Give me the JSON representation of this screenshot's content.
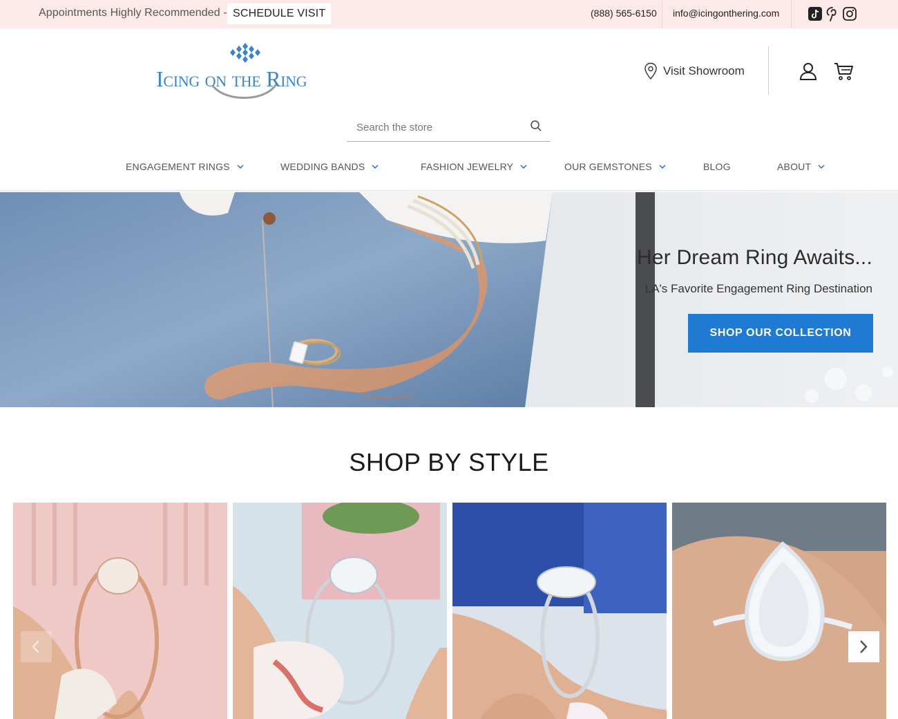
{
  "topbar": {
    "appointment_text": "Appointments Highly Recommended -",
    "schedule_label": "SCHEDULE VISIT",
    "phone": "(888) 565-6150",
    "email": "info@icingonthering.com",
    "social_icons": [
      "tiktok-icon",
      "pinterest-icon",
      "instagram-icon"
    ]
  },
  "header": {
    "logo_text": "Icing on the Ring",
    "visit_label": "Visit Showroom"
  },
  "search": {
    "placeholder": "Search the store"
  },
  "nav": {
    "items": [
      {
        "label": "ENGAGEMENT RINGS",
        "has_dropdown": true
      },
      {
        "label": "WEDDING BANDS",
        "has_dropdown": true
      },
      {
        "label": "FASHION JEWELRY",
        "has_dropdown": true
      },
      {
        "label": "OUR GEMSTONES",
        "has_dropdown": true
      },
      {
        "label": "BLOG",
        "has_dropdown": false
      },
      {
        "label": "ABOUT",
        "has_dropdown": true
      }
    ]
  },
  "hero": {
    "title": "Her Dream Ring Awaits...",
    "subtitle": "LA's Favorite Engagement Ring Destination",
    "button_label": "SHOP OUR COLLECTION"
  },
  "section": {
    "title": "SHOP BY STYLE"
  },
  "colors": {
    "topbar_bg": "#fde9e7",
    "accent_blue": "#1f7ad3",
    "logo_blue": "#3a86c8"
  }
}
